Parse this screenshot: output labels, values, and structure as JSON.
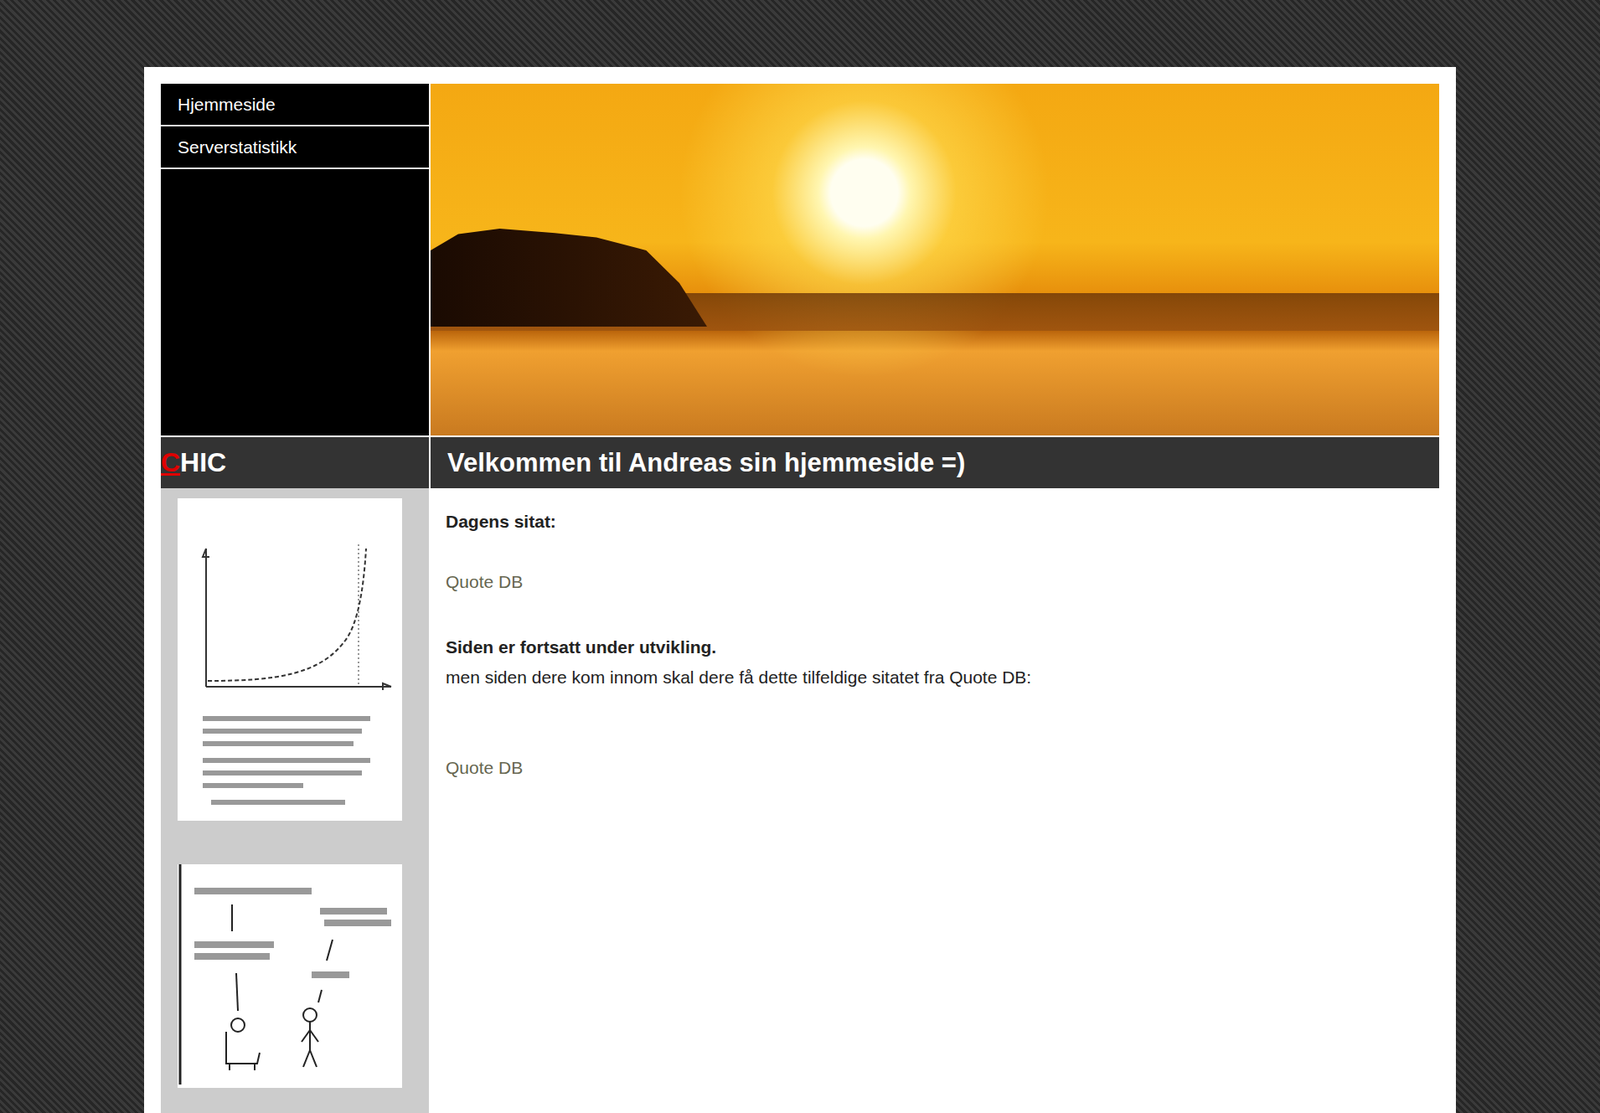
{
  "nav": [
    {
      "label": "Hjemmeside"
    },
    {
      "label": "Serverstatistikk"
    }
  ],
  "logo": {
    "first": "C",
    "rest": "HIC"
  },
  "heading": "Velkommen til Andreas sin hjemmeside =)",
  "content": [
    {
      "kind": "bold",
      "text": "Dagens sitat:"
    },
    {
      "kind": "link",
      "text": "Quote DB"
    },
    {
      "kind": "bold",
      "text": "Siden er fortsatt under utvikling."
    },
    {
      "kind": "text",
      "text": "men siden dere kom innom skal dere få dette tilfeldige sitatet fra Quote DB:"
    },
    {
      "kind": "link",
      "text": "Quote DB"
    }
  ]
}
